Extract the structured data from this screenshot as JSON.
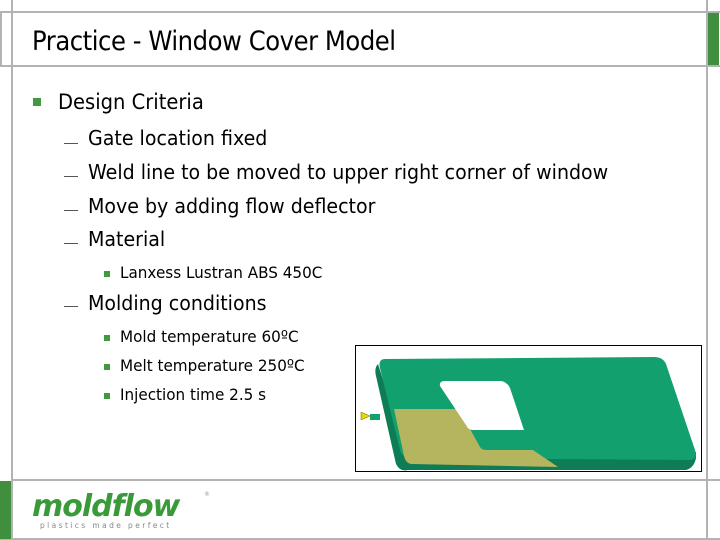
{
  "slide": {
    "title": "Practice - Window Cover Model",
    "bullets": {
      "design_criteria": "Design Criteria",
      "gate": "Gate location fixed",
      "weld": "Weld line to be moved to upper right corner of window",
      "move": "Move by adding flow deflector",
      "material": "Material",
      "material_item": "Lanxess Lustran ABS 450C",
      "molding": "Molding conditions",
      "mold_temp": "Mold temperature 60ºC",
      "melt_temp": "Melt temperature 250ºC",
      "injection": "Injection time 2.5 s"
    }
  },
  "colors": {
    "accent": "#3f8f3f",
    "part": "#13a06f",
    "deflector": "#b5b45f",
    "frame": "#b3b3b3"
  },
  "logo": {
    "name": "moldflow",
    "tagline": "plastics made perfect",
    "mark": "®"
  }
}
